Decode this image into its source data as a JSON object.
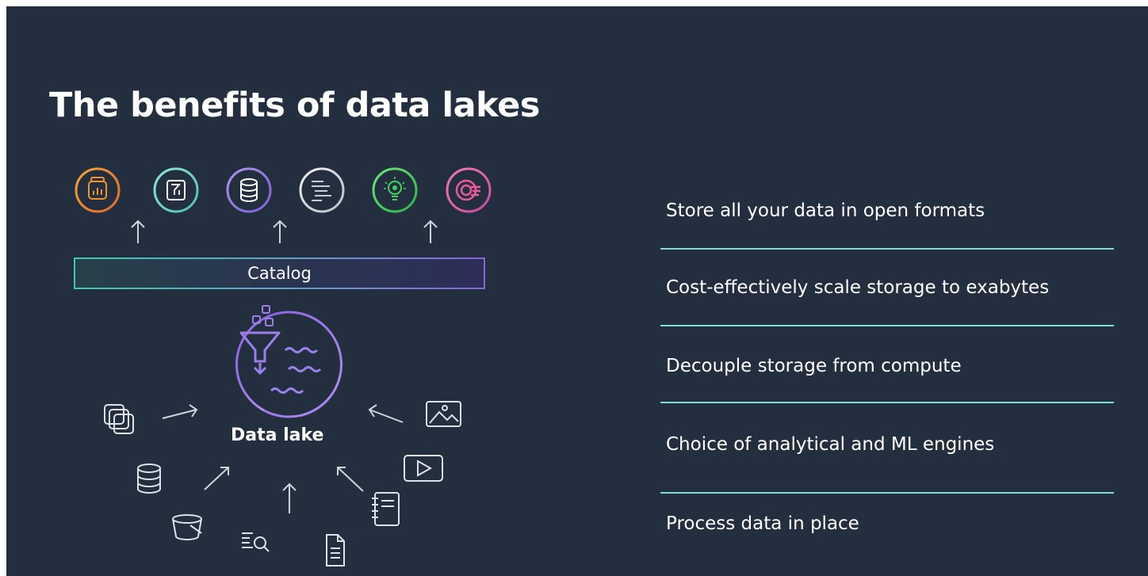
{
  "title": "The benefits of data lakes",
  "diagram": {
    "catalog_label": "Catalog",
    "data_lake_label": "Data lake",
    "analytics_icons": [
      "analytics-dashboard-icon",
      "document-translation-icon",
      "database-icon",
      "code-editor-icon",
      "ml-lightbulb-icon",
      "targeting-icon"
    ],
    "source_icons": [
      "stacked-layers-icon",
      "database-stack-icon",
      "storage-bucket-icon",
      "log-search-icon",
      "document-icon",
      "notebook-icon",
      "video-icon",
      "image-icon"
    ],
    "colors": {
      "orange": "#f0922f",
      "teal": "#7de0d0",
      "purple": "#9b7ee8",
      "green": "#3fd35b",
      "pink": "#e85a9a",
      "line": "#cfd4d9"
    }
  },
  "benefits": [
    "Store all your data in open formats",
    "Cost-effectively scale storage to exabytes",
    "Decouple storage from compute",
    "Choice of analytical and ML engines",
    "Process data in place"
  ]
}
